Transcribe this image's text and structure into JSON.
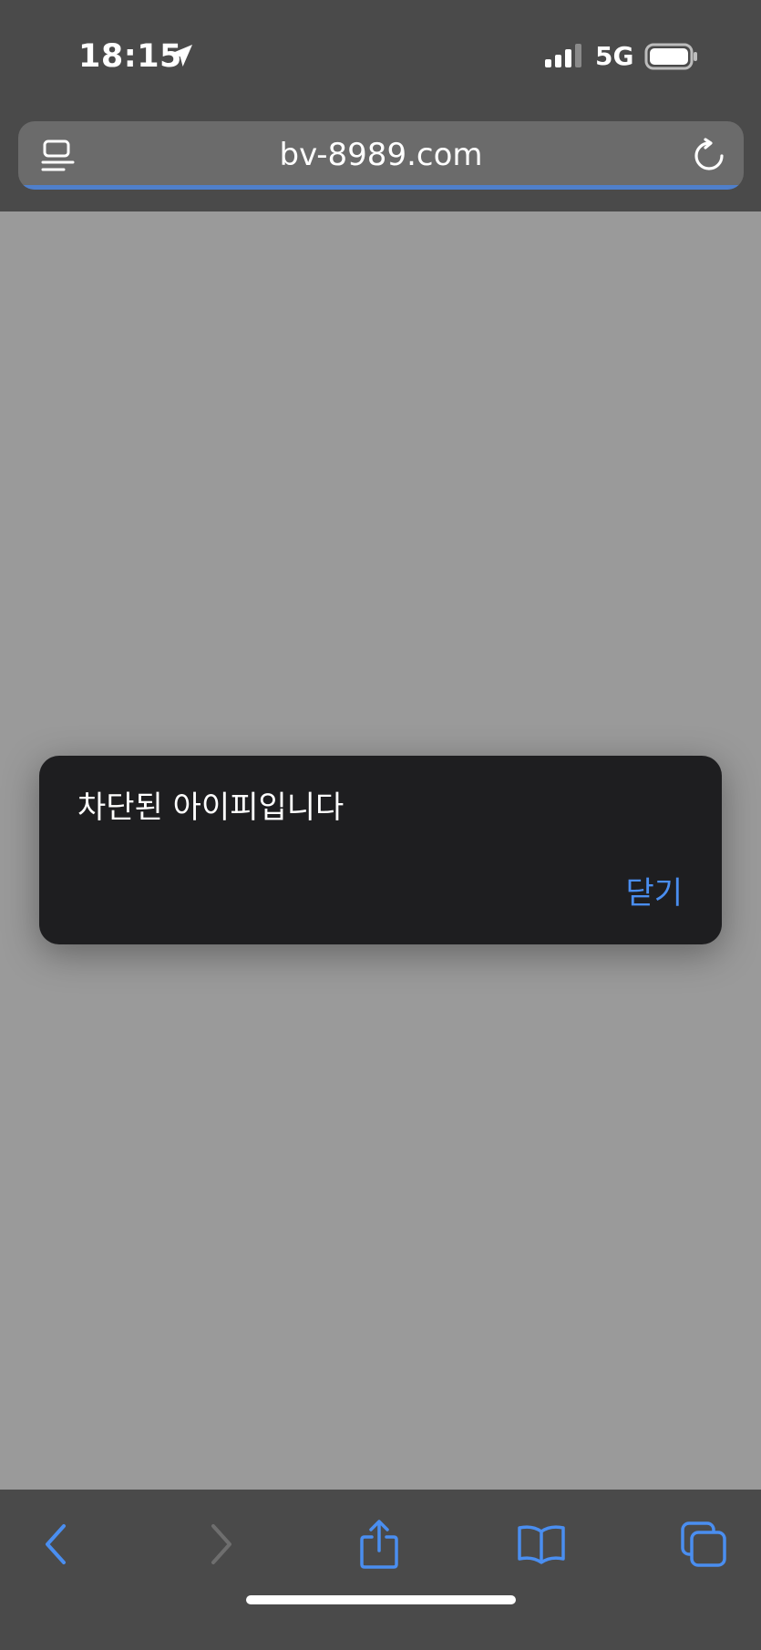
{
  "status_bar": {
    "time": "18:15",
    "network": "5G"
  },
  "address_bar": {
    "url": "bv-8989.com"
  },
  "alert": {
    "message": "차단된 아이피입니다",
    "close_label": "닫기"
  },
  "colors": {
    "accent": "#4a8ef0",
    "chrome_background": "#4a4a4a",
    "page_background": "#9a9a9a",
    "dialog_background": "#1e1e20"
  },
  "icons": {
    "status": [
      "location-arrow-icon",
      "signal-bars-icon",
      "battery-icon"
    ],
    "address": [
      "reader-mode-icon",
      "reload-icon"
    ],
    "toolbar": [
      "back-chevron-icon",
      "forward-chevron-icon",
      "share-icon",
      "bookmarks-book-icon",
      "tabs-icon"
    ]
  }
}
